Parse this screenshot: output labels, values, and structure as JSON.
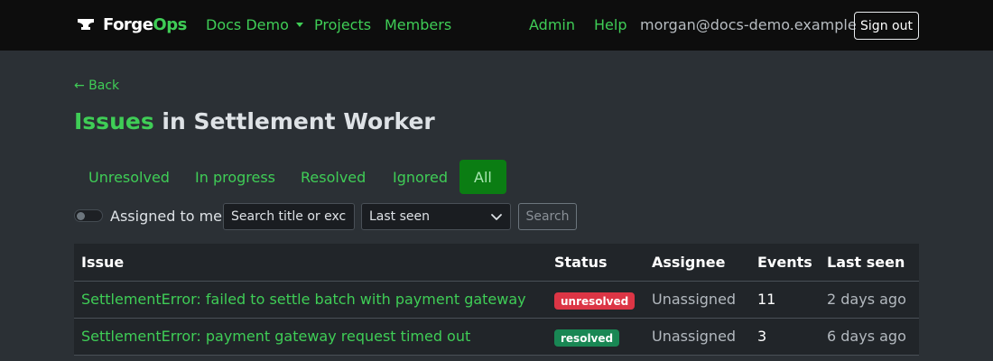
{
  "navbar": {
    "brand_a": "Forge",
    "brand_b": "Ops",
    "org_menu": "Docs Demo",
    "projects": "Projects",
    "members": "Members",
    "admin": "Admin",
    "help": "Help",
    "user_email": "morgan@docs-demo.example",
    "sign_out": "Sign out"
  },
  "page": {
    "back": "← Back",
    "title_accent": "Issues",
    "title_rest": " in Settlement Worker"
  },
  "tabs": [
    "Unresolved",
    "In progress",
    "Resolved",
    "Ignored",
    "All"
  ],
  "active_tab": "All",
  "filters": {
    "assigned_label": "Assigned to me",
    "search_placeholder": "Search title or exce",
    "sort_selected": "Last seen",
    "search_button": "Search"
  },
  "table": {
    "headers": [
      "Issue",
      "Status",
      "Assignee",
      "Events",
      "Last seen"
    ],
    "rows": [
      {
        "issue": "SettlementError: failed to settle batch with payment gateway",
        "status": "unresolved",
        "assignee": "Unassigned",
        "events": "11",
        "last_seen": "2 days ago"
      },
      {
        "issue": "SettlementError: payment gateway request timed out",
        "status": "resolved",
        "assignee": "Unassigned",
        "events": "3",
        "last_seen": "6 days ago"
      }
    ]
  },
  "colors": {
    "accent": "#3fcd56",
    "active_tab_bg": "#0b7d13",
    "badge_unresolved": "#dc3545",
    "badge_resolved": "#198754"
  }
}
